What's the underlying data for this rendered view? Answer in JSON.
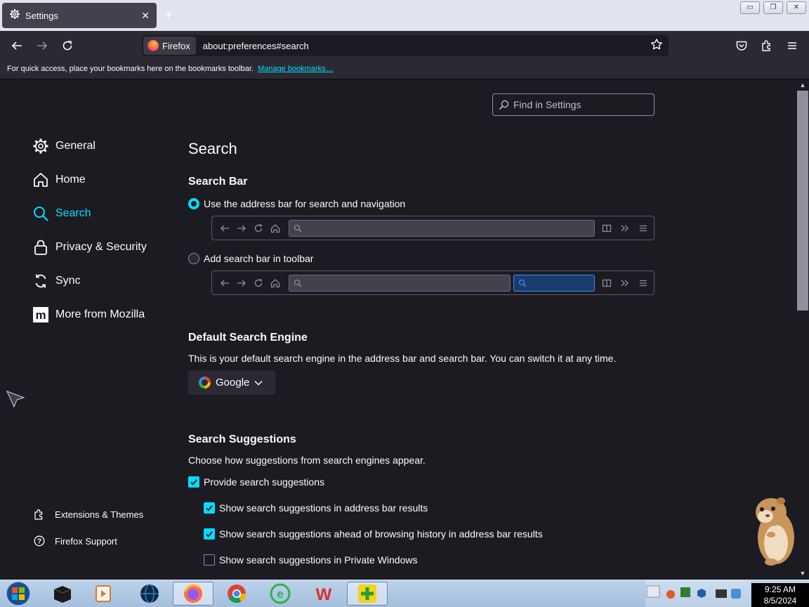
{
  "browser": {
    "tab_title": "Settings",
    "new_tab_label": "+",
    "identity_label": "Firefox",
    "url": "about:preferences#search",
    "bookmarks_message": "For quick access, place your bookmarks here on the bookmarks toolbar.",
    "bookmarks_link": "Manage bookmarks…"
  },
  "settings": {
    "find_placeholder": "Find in Settings",
    "categories": [
      {
        "label": "General",
        "icon": "gear-icon"
      },
      {
        "label": "Home",
        "icon": "home-icon"
      },
      {
        "label": "Search",
        "icon": "search-icon",
        "selected": true
      },
      {
        "label": "Privacy & Security",
        "icon": "lock-icon"
      },
      {
        "label": "Sync",
        "icon": "sync-icon"
      },
      {
        "label": "More from Mozilla",
        "icon": "mozilla-icon"
      }
    ],
    "footer_links": [
      {
        "label": "Extensions & Themes",
        "icon": "puzzle-icon"
      },
      {
        "label": "Firefox Support",
        "icon": "help-icon"
      }
    ],
    "page_heading": "Search",
    "search_bar": {
      "heading": "Search Bar",
      "option_address_bar": "Use the address bar for search and navigation",
      "option_toolbar": "Add search bar in toolbar",
      "selected": "address_bar"
    },
    "default_engine": {
      "heading": "Default Search Engine",
      "description": "This is your default search engine in the address bar and search bar. You can switch it at any time.",
      "selected": "Google"
    },
    "suggestions": {
      "heading": "Search Suggestions",
      "description": "Choose how suggestions from search engines appear.",
      "provide": {
        "label": "Provide search suggestions",
        "checked": true
      },
      "in_address_bar": {
        "label": "Show search suggestions in address bar results",
        "checked": true
      },
      "ahead_of_history": {
        "label": "Show search suggestions ahead of browsing history in address bar results",
        "checked": true
      },
      "private_windows": {
        "label": "Show search suggestions in Private Windows",
        "checked": false
      }
    }
  },
  "taskbar": {
    "time": "9:25 AM",
    "date": "8/5/2024"
  },
  "colors": {
    "accent": "#00ddff",
    "background": "#1c1b22",
    "toolbar": "#2b2a33"
  }
}
